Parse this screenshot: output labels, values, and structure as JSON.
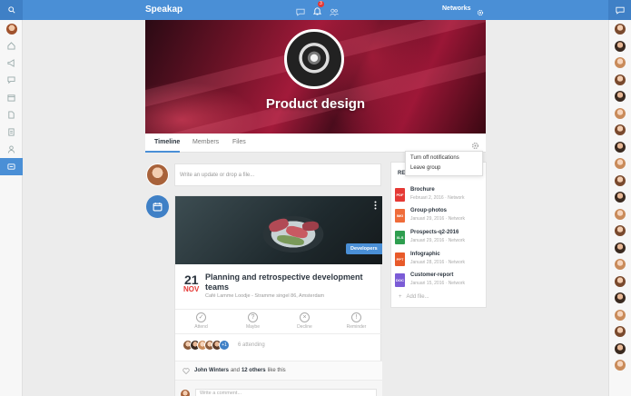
{
  "topbar": {
    "brand": "Speakap",
    "notification_count": "3",
    "networks_label": "Networks"
  },
  "group": {
    "name": "Product design",
    "tabs": [
      "Timeline",
      "Members",
      "Files"
    ]
  },
  "group_menu": {
    "items": [
      "Turn off notifications",
      "Leave group"
    ]
  },
  "composer": {
    "placeholder": "Write an update or drop a file..."
  },
  "event": {
    "tag": "Developers",
    "day": "21",
    "month": "NOV",
    "title": "Planning and retrospective development teams",
    "location": "Café Lamme Loodje - Stramme singel 86, Amsterdam",
    "rsvp": [
      "Attend",
      "Maybe",
      "Decline",
      "Reminder"
    ],
    "attendee_more": "+1",
    "attending_text": "6 attending",
    "likes_name": "John Winters",
    "likes_and": "and",
    "likes_others": "12 others",
    "likes_suffix": "like this",
    "comment_placeholder": "Write a comment..."
  },
  "resources": {
    "header": "RE",
    "files": [
      {
        "name": "Brochure",
        "meta": "Februari 2, 2016 · Network",
        "type": "PDF",
        "color": "#e53935"
      },
      {
        "name": "Group-photos",
        "meta": "Januari 29, 2016 · Network",
        "type": "IMG",
        "color": "#ef6c3a"
      },
      {
        "name": "Prospects-q2-2016",
        "meta": "Januari 29, 2016 · Network",
        "type": "XLS",
        "color": "#2e9e4f"
      },
      {
        "name": "Infographic",
        "meta": "Januari 28, 2016 · Network",
        "type": "PPT",
        "color": "#e85a2a"
      },
      {
        "name": "Customer-report",
        "meta": "Januari 15, 2016 · Network",
        "type": "DOC",
        "color": "#7b5cd6"
      }
    ],
    "add_label": "Add file..."
  },
  "colors": {
    "topbar": "#4a8fd6",
    "accent": "#3f80c6",
    "date_month": "#e53935"
  }
}
